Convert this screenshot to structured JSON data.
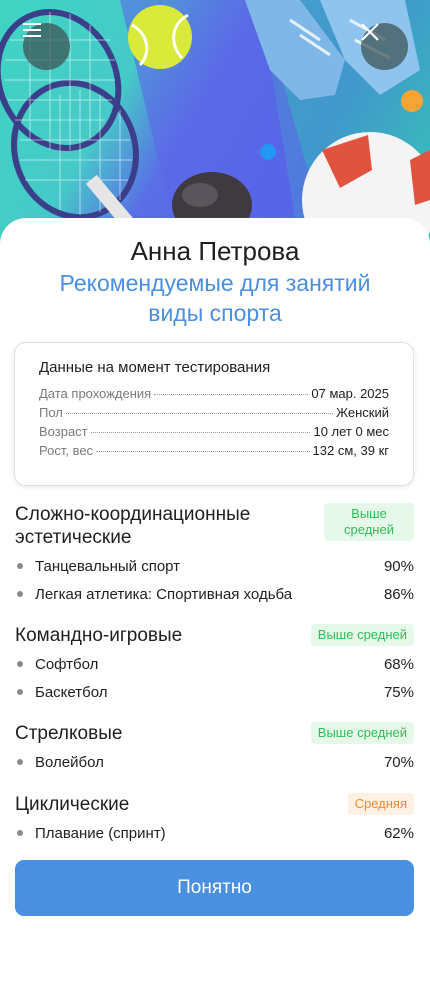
{
  "header": {
    "menu_icon": "menu-icon",
    "close_icon": "close-icon"
  },
  "profile": {
    "name": "Анна Петрова",
    "subtitle": "Рекомендуемые для занятий виды спорта"
  },
  "test_info": {
    "title": "Данные на момент тестирования",
    "rows": [
      {
        "label": "Дата прохождения",
        "value": "07 мар. 2025"
      },
      {
        "label": "Пол",
        "value": "Женский"
      },
      {
        "label": "Возраст",
        "value": "10 лет 0 мес"
      },
      {
        "label": "Рост, вес",
        "value": "132 см, 39 кг"
      }
    ]
  },
  "groups": [
    {
      "title": "Сложно-координационные эстетические",
      "badge": "Выше средней",
      "badge_level": "high",
      "items": [
        {
          "label": "Танцевальный спорт",
          "percent": "90%"
        },
        {
          "label": "Легкая атлетика: Спортивная ходьба",
          "percent": "86%"
        }
      ]
    },
    {
      "title": "Командно-игровые",
      "badge": "Выше средней",
      "badge_level": "high",
      "items": [
        {
          "label": "Софтбол",
          "percent": "68%"
        },
        {
          "label": "Баскетбол",
          "percent": "75%"
        }
      ]
    },
    {
      "title": "Стрелковые",
      "badge": "Выше средней",
      "badge_level": "high",
      "items": [
        {
          "label": "Волейбол",
          "percent": "70%"
        }
      ]
    },
    {
      "title": "Циклические",
      "badge": "Средняя",
      "badge_level": "mid",
      "items": [
        {
          "label": "Плавание (спринт)",
          "percent": "62%"
        }
      ]
    }
  ],
  "actions": {
    "confirm_label": "Понятно"
  },
  "colors": {
    "accent": "#4a8fe0",
    "badge_high_text": "#2fbf55",
    "badge_high_bg": "#e6f8ea",
    "badge_mid_text": "#ee8a2e",
    "badge_mid_bg": "#fff1e4"
  }
}
